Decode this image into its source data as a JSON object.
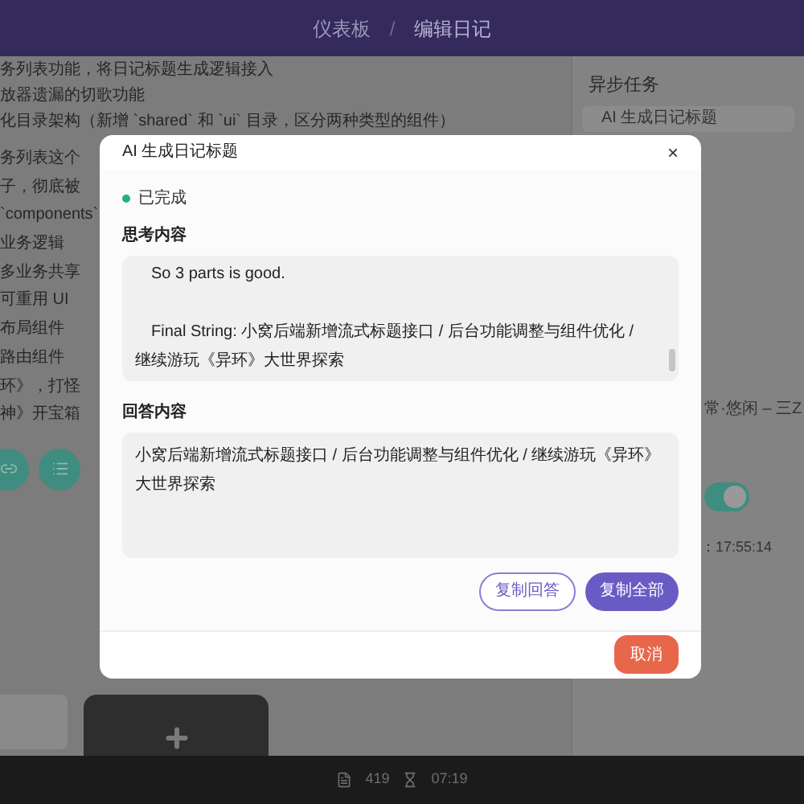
{
  "header": {
    "breadcrumbs": [
      {
        "label": "仪表板",
        "selected": false
      },
      {
        "label": "编辑日记",
        "selected": true
      }
    ],
    "separator": "/"
  },
  "editor_lines": [
    "务列表功能，将日记标题生成逻辑接入",
    "放器遗漏的切歌功能",
    "化目录架构（新增 `shared` 和 `ui` 目录，区分两种类型的组件）",
    "务列表这个",
    "子，彻底被",
    "`components`",
    "业务逻辑",
    "多业务共享",
    "可重用 UI",
    "布局组件",
    "路由组件",
    "环》，打怪",
    "神》开宝箱"
  ],
  "side_panel": {
    "title": "异步任务",
    "items": [
      {
        "label": "AI 生成日记标题",
        "selected": true
      }
    ],
    "music": "常·悠闲 – 三Z",
    "toggle": {
      "on": true
    },
    "time": "：17:55:14"
  },
  "footer": {
    "words": "419",
    "duration": "07:19"
  },
  "dialog": {
    "title": "AI 生成日记标题",
    "close": "×",
    "status": {
      "label": "已完成",
      "color": "#22b07d"
    },
    "thinking_label": "思考内容",
    "thinking_lines": [
      "So 3 parts is good.",
      "Final String: 小窝后端新增流式标题接口 / 后台功能调整与组件优化 / 继续游玩《异环》大世界探索"
    ],
    "answer_label": "回答内容",
    "answer": "小窝后端新增流式标题接口 / 后台功能调整与组件优化 / 继续游玩《异环》大世界探索",
    "actions": [
      {
        "label": "复制回答",
        "kind": "outline"
      },
      {
        "label": "复制全部",
        "kind": "filled"
      }
    ],
    "cancel": "取消"
  }
}
